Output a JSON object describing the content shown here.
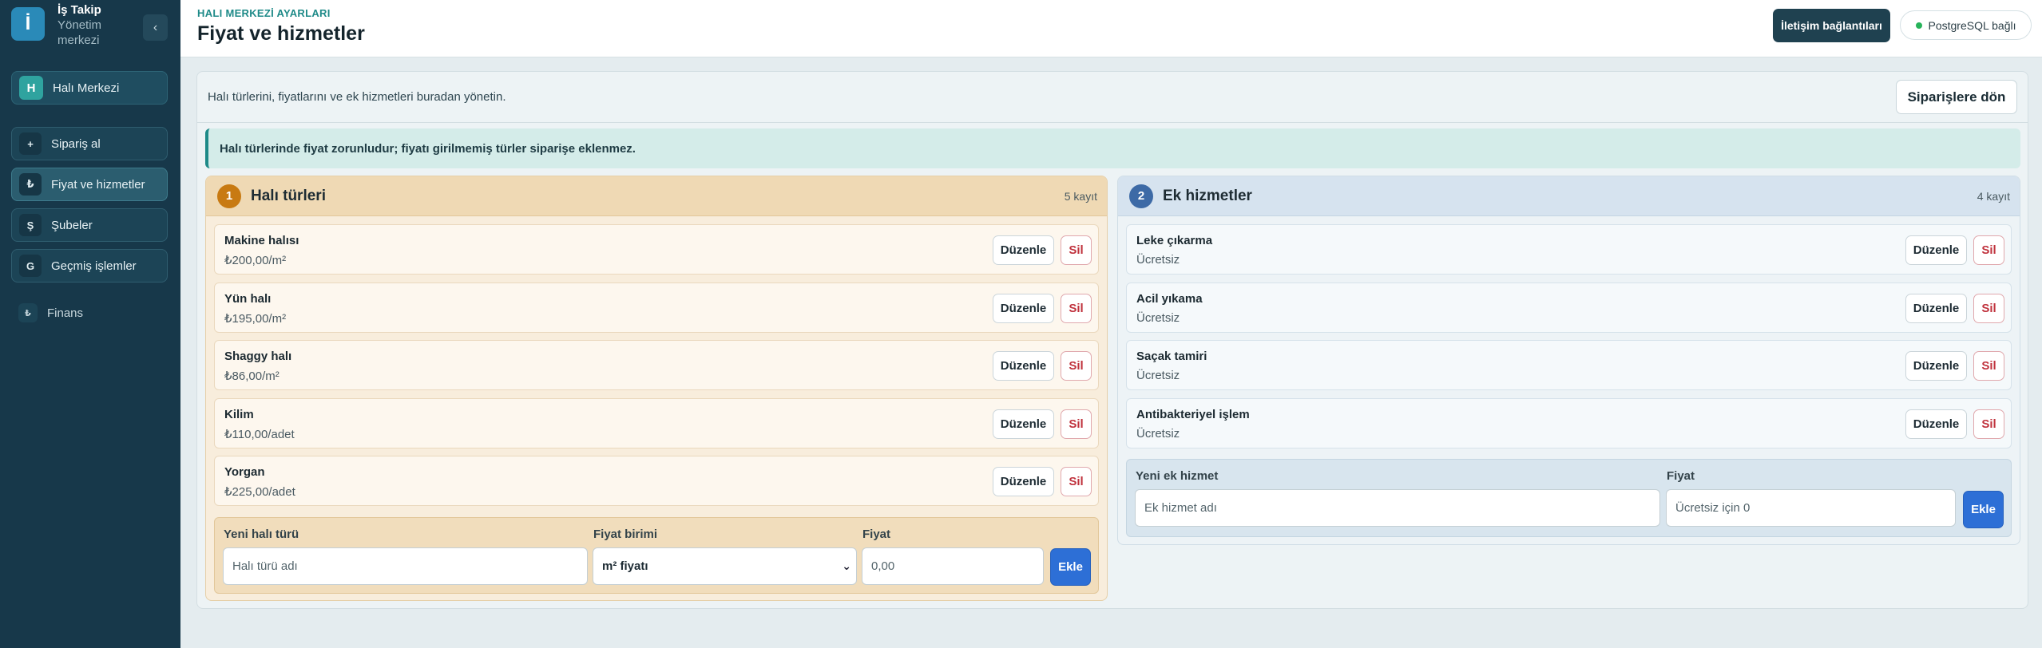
{
  "brand": {
    "logo_letter": "İ",
    "title": "İş Takip",
    "subtitle": "Yönetim merkezi",
    "collapse_label": "‹"
  },
  "sidebar": {
    "primary": {
      "icon_letter": "H",
      "label": "Halı Merkezi"
    },
    "items": [
      {
        "icon_letter": "+",
        "label": "Sipariş al"
      },
      {
        "icon_letter": "₺",
        "label": "Fiyat ve hizmetler"
      },
      {
        "icon_letter": "Ş",
        "label": "Şubeler"
      },
      {
        "icon_letter": "G",
        "label": "Geçmiş işlemler"
      }
    ],
    "finance": {
      "icon_letter": "₺",
      "label": "Finans"
    },
    "active_index": 1
  },
  "header": {
    "eyebrow": "HALI MERKEZİ AYARLARI",
    "title": "Fiyat ve hizmetler",
    "connections_button": "İletişim bağlantıları",
    "db_status": "PostgreSQL bağlı",
    "db_status_color": "#27b35a"
  },
  "panel": {
    "description": "Halı türlerini, fiyatlarını ve ek hizmetleri buradan yönetin.",
    "back_button": "Siparişlere dön",
    "notice": "Halı türlerinde fiyat zorunludur; fiyatı girilmemiş türler siparişe eklenmez."
  },
  "rugs": {
    "number": "1",
    "title": "Halı türleri",
    "count": "5 kayıt",
    "edit_label": "Düzenle",
    "delete_label": "Sil",
    "items": [
      {
        "name": "Makine halısı",
        "price": "₺200,00/m²"
      },
      {
        "name": "Yün halı",
        "price": "₺195,00/m²"
      },
      {
        "name": "Shaggy halı",
        "price": "₺86,00/m²"
      },
      {
        "name": "Kilim",
        "price": "₺110,00/adet"
      },
      {
        "name": "Yorgan",
        "price": "₺225,00/adet"
      }
    ],
    "form": {
      "name_label": "Yeni halı türü",
      "name_placeholder": "Halı türü adı",
      "unit_label": "Fiyat birimi",
      "unit_value": "m² fiyatı",
      "price_label": "Fiyat",
      "price_placeholder": "0,00",
      "add_button": "Ekle"
    }
  },
  "extras": {
    "number": "2",
    "title": "Ek hizmetler",
    "count": "4 kayıt",
    "edit_label": "Düzenle",
    "delete_label": "Sil",
    "items": [
      {
        "name": "Leke çıkarma",
        "price": "Ücretsiz"
      },
      {
        "name": "Acil yıkama",
        "price": "Ücretsiz"
      },
      {
        "name": "Saçak tamiri",
        "price": "Ücretsiz"
      },
      {
        "name": "Antibakteriyel işlem",
        "price": "Ücretsiz"
      }
    ],
    "form": {
      "name_label": "Yeni ek hizmet",
      "name_placeholder": "Ek hizmet adı",
      "price_label": "Fiyat",
      "price_placeholder": "Ücretsiz için 0",
      "add_button": "Ekle"
    }
  }
}
